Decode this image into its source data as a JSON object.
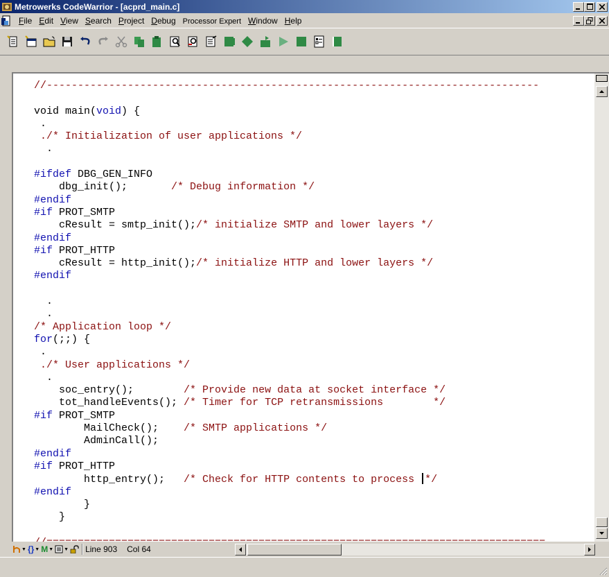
{
  "window": {
    "title": "Metrowerks CodeWarrior - [acprd_main.c]",
    "minimize": "_",
    "maximize": "□",
    "close": "×",
    "restore": "🗗"
  },
  "menu": [
    {
      "label": "File",
      "u": "F",
      "rest": "ile"
    },
    {
      "label": "Edit",
      "u": "E",
      "rest": "dit"
    },
    {
      "label": "View",
      "u": "V",
      "rest": "iew"
    },
    {
      "label": "Search",
      "u": "S",
      "rest": "earch"
    },
    {
      "label": "Project",
      "u": "P",
      "rest": "roject"
    },
    {
      "label": "Debug",
      "u": "D",
      "rest": "ebug"
    },
    {
      "label": "Processor Expert",
      "u": "",
      "rest": "Processor Expert"
    },
    {
      "label": "Window",
      "u": "W",
      "rest": "indow"
    },
    {
      "label": "Help",
      "u": "H",
      "rest": "elp"
    }
  ],
  "toolbar": {
    "icons": [
      "new-text-file-icon",
      "new-project-icon",
      "open-folder-icon",
      "save-icon",
      "undo-icon",
      "redo-icon",
      "cut-icon",
      "copy-icon",
      "paste-icon",
      "find-icon",
      "find-next-icon",
      "replace-icon",
      "compile-icon",
      "make-icon",
      "debug-icon",
      "run-icon",
      "stop-icon",
      "preferences-icon",
      "project-window-icon"
    ]
  },
  "code": {
    "lines": [
      {
        "segs": [
          {
            "t": "//-------------------------------------------------------------------------------",
            "c": "cm"
          }
        ]
      },
      {
        "segs": [
          {
            "t": "",
            "c": ""
          }
        ]
      },
      {
        "segs": [
          {
            "t": "void main(",
            "c": ""
          },
          {
            "t": "void",
            "c": "kw"
          },
          {
            "t": ") {",
            "c": ""
          }
        ]
      },
      {
        "segs": [
          {
            "t": " .",
            "c": ""
          }
        ]
      },
      {
        "segs": [
          {
            "t": " ./* Initialization of user applications */",
            "c": "cm"
          }
        ]
      },
      {
        "segs": [
          {
            "t": "  .",
            "c": ""
          }
        ]
      },
      {
        "segs": [
          {
            "t": "",
            "c": ""
          }
        ]
      },
      {
        "segs": [
          {
            "t": "#ifdef",
            "c": "kw"
          },
          {
            "t": " DBG_GEN_INFO",
            "c": ""
          }
        ]
      },
      {
        "segs": [
          {
            "t": "    dbg_init();       ",
            "c": ""
          },
          {
            "t": "/* Debug information */",
            "c": "cm"
          }
        ]
      },
      {
        "segs": [
          {
            "t": "#endif",
            "c": "kw"
          }
        ]
      },
      {
        "segs": [
          {
            "t": "#if",
            "c": "kw"
          },
          {
            "t": " PROT_SMTP",
            "c": ""
          }
        ]
      },
      {
        "segs": [
          {
            "t": "    cResult = smtp_init();",
            "c": ""
          },
          {
            "t": "/* initialize SMTP and lower layers */",
            "c": "cm"
          }
        ]
      },
      {
        "segs": [
          {
            "t": "#endif",
            "c": "kw"
          }
        ]
      },
      {
        "segs": [
          {
            "t": "#if",
            "c": "kw"
          },
          {
            "t": " PROT_HTTP",
            "c": ""
          }
        ]
      },
      {
        "segs": [
          {
            "t": "    cResult = http_init();",
            "c": ""
          },
          {
            "t": "/* initialize HTTP and lower layers */",
            "c": "cm"
          }
        ]
      },
      {
        "segs": [
          {
            "t": "#endif",
            "c": "kw"
          }
        ]
      },
      {
        "segs": [
          {
            "t": "",
            "c": ""
          }
        ]
      },
      {
        "segs": [
          {
            "t": "  .",
            "c": ""
          }
        ]
      },
      {
        "segs": [
          {
            "t": "  .",
            "c": ""
          }
        ]
      },
      {
        "segs": [
          {
            "t": "/* Application loop */",
            "c": "cm"
          }
        ]
      },
      {
        "segs": [
          {
            "t": "for",
            "c": "kw"
          },
          {
            "t": "(;;) {",
            "c": ""
          }
        ]
      },
      {
        "segs": [
          {
            "t": " .",
            "c": ""
          }
        ]
      },
      {
        "segs": [
          {
            "t": " ./* User applications */",
            "c": "cm"
          }
        ]
      },
      {
        "segs": [
          {
            "t": "  .",
            "c": ""
          }
        ]
      },
      {
        "segs": [
          {
            "t": "    soc_entry();        ",
            "c": ""
          },
          {
            "t": "/* Provide new data at socket interface */",
            "c": "cm"
          }
        ]
      },
      {
        "segs": [
          {
            "t": "    tot_handleEvents(); ",
            "c": ""
          },
          {
            "t": "/* Timer for TCP retransmissions        */",
            "c": "cm"
          }
        ]
      },
      {
        "segs": [
          {
            "t": "#if",
            "c": "kw"
          },
          {
            "t": " PROT_SMTP",
            "c": ""
          }
        ]
      },
      {
        "segs": [
          {
            "t": "        MailCheck();    ",
            "c": ""
          },
          {
            "t": "/* SMTP applications */",
            "c": "cm"
          }
        ]
      },
      {
        "segs": [
          {
            "t": "        AdminCall();",
            "c": ""
          }
        ]
      },
      {
        "segs": [
          {
            "t": "#endif",
            "c": "kw"
          }
        ]
      },
      {
        "segs": [
          {
            "t": "#if",
            "c": "kw"
          },
          {
            "t": " PROT_HTTP",
            "c": ""
          }
        ]
      },
      {
        "segs": [
          {
            "t": "        http_entry();   ",
            "c": ""
          },
          {
            "t": "/* Check for HTTP contents to process ",
            "c": "cm"
          },
          {
            "t": "CARET",
            "c": "caret"
          },
          {
            "t": "*/",
            "c": "cm"
          }
        ]
      },
      {
        "segs": [
          {
            "t": "#endif",
            "c": "kw"
          }
        ]
      },
      {
        "segs": [
          {
            "t": "        }",
            "c": ""
          }
        ]
      },
      {
        "segs": [
          {
            "t": "    }",
            "c": ""
          }
        ]
      },
      {
        "segs": [
          {
            "t": "",
            "c": ""
          }
        ]
      },
      {
        "segs": [
          {
            "t": "//================================================================================",
            "c": "cm"
          }
        ]
      }
    ]
  },
  "status": {
    "line": "Line 903",
    "col": "Col 64",
    "icon_labels": [
      "{}",
      "M"
    ]
  }
}
